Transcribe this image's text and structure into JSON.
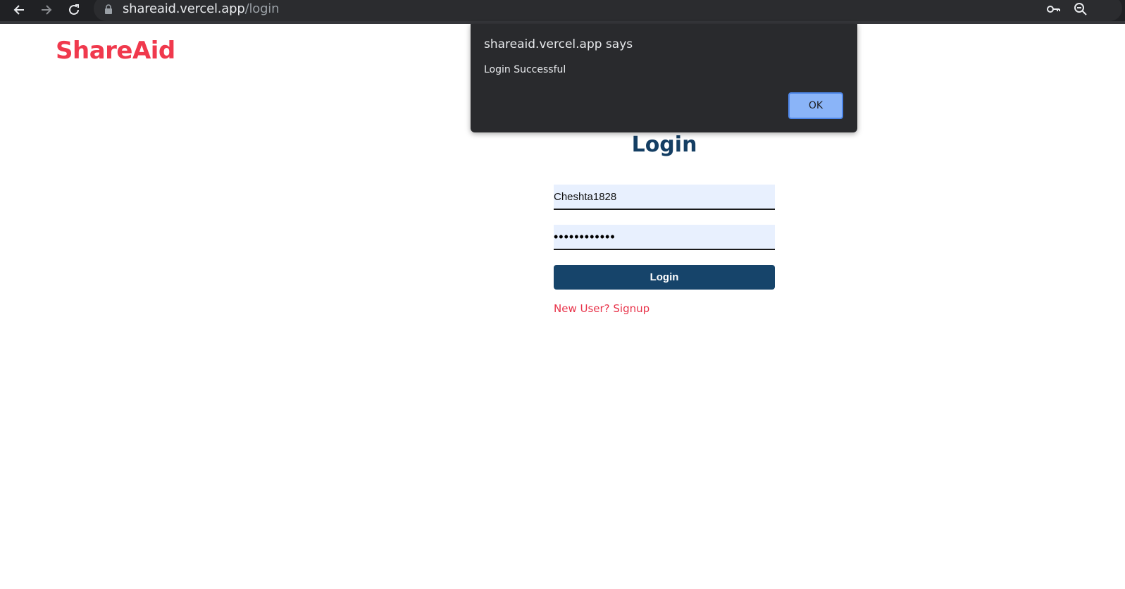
{
  "browser": {
    "url_host": "shareaid.vercel.app",
    "url_path": "/login",
    "icons": [
      "back-icon",
      "forward-icon",
      "reload-icon",
      "lock-icon",
      "key-icon",
      "zoom-out-icon"
    ]
  },
  "page": {
    "logo": "ShareAid",
    "title": "Login",
    "username_value": "Cheshta1828",
    "password_mask": "••••••••••••",
    "login_button": "Login",
    "signup_link": "New User? Signup"
  },
  "dialog": {
    "title": "shareaid.vercel.app says",
    "message": "Login Successful",
    "ok_label": "OK"
  },
  "colors": {
    "brand": "#f0394d",
    "title": "#143e63",
    "button": "#16446a",
    "input_bg": "#e8f0fe",
    "dialog_bg": "#292a2d",
    "ok_button": "#8ab4f8"
  }
}
